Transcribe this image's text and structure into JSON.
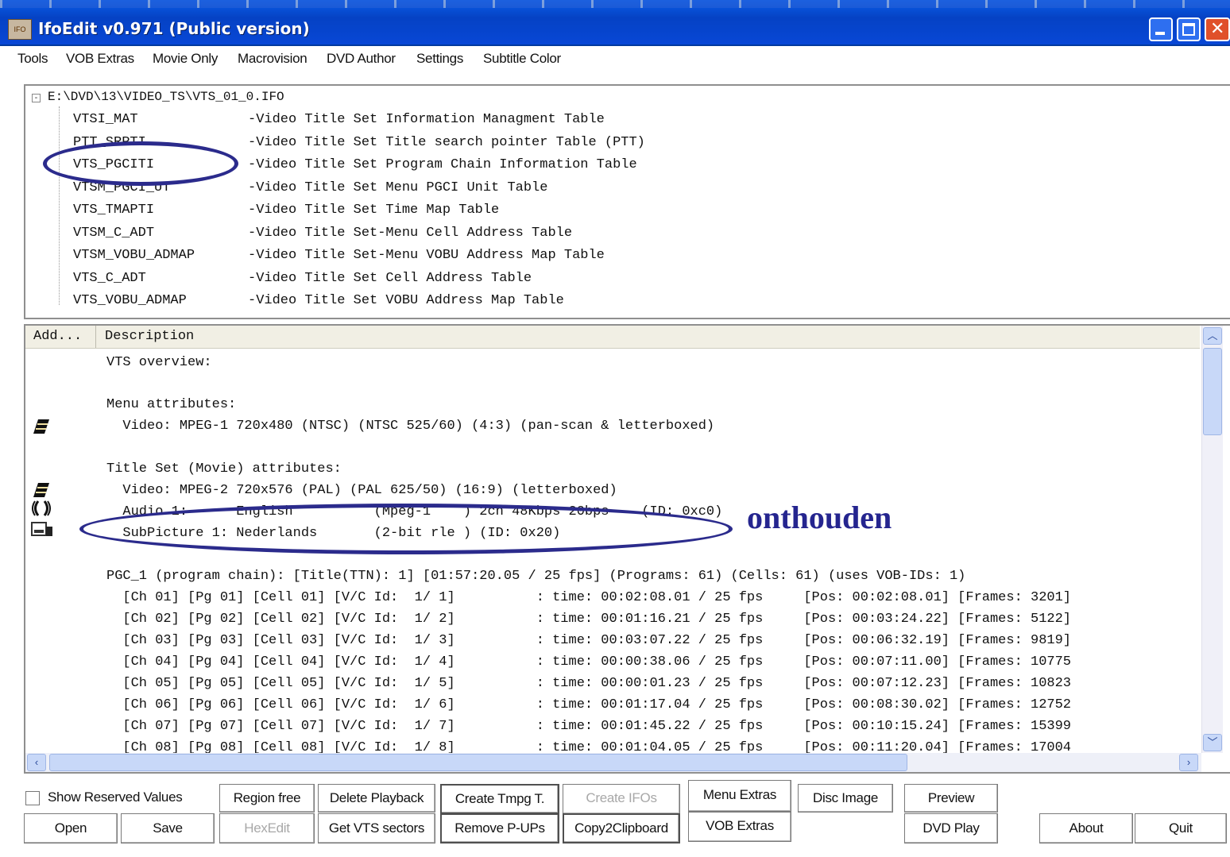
{
  "window": {
    "title": "IfoEdit v0.971 (Public version)",
    "app_icon": "ifo-app-icon",
    "controls": [
      "minimize-icon",
      "maximize-icon",
      "close-icon"
    ]
  },
  "menu": [
    "Tools",
    "VOB Extras",
    "Movie Only",
    "Macrovision",
    "DVD Author",
    "Settings",
    "Subtitle Color"
  ],
  "tree": {
    "root": "E:\\DVD\\13\\VIDEO_TS\\VTS_01_0.IFO",
    "items": [
      {
        "name": "VTSI_MAT",
        "desc": "-Video Title Set Information Managment Table"
      },
      {
        "name": "PTT_SRPTI",
        "desc": "-Video Title Set Title search pointer Table (PTT)"
      },
      {
        "name": "VTS_PGCITI",
        "desc": "-Video Title Set Program Chain Information Table"
      },
      {
        "name": "VTSM_PGCI_UT",
        "desc": "-Video Title Set Menu PGCI Unit Table"
      },
      {
        "name": "VTS_TMAPTI",
        "desc": "-Video Title Set Time Map Table"
      },
      {
        "name": "VTSM_C_ADT",
        "desc": "-Video Title Set-Menu Cell Address Table"
      },
      {
        "name": "VTSM_VOBU_ADMAP",
        "desc": "-Video Title Set-Menu VOBU Address Map Table"
      },
      {
        "name": "VTS_C_ADT",
        "desc": "-Video Title Set Cell Address Table"
      },
      {
        "name": "VTS_VOBU_ADMAP",
        "desc": "-Video Title Set VOBU Address Map Table"
      }
    ]
  },
  "list": {
    "headers": [
      "Add...",
      "Description"
    ],
    "lines": [
      "VTS overview:",
      "",
      "Menu attributes:",
      "  Video: MPEG-1 720x480 (NTSC) (NTSC 525/60) (4:3) (pan-scan & letterboxed)",
      "",
      "Title Set (Movie) attributes:",
      "  Video: MPEG-2 720x576 (PAL) (PAL 625/50) (16:9) (letterboxed)",
      "  Audio 1:      English          (Mpeg-1    ) 2ch 48Kbps 20bps    (ID: 0xc0)",
      "  SubPicture 1: Nederlands       (2-bit rle ) (ID: 0x20)",
      "",
      "PGC_1 (program chain): [Title(TTN): 1] [01:57:20.05 / 25 fps] (Programs: 61) (Cells: 61) (uses VOB-IDs: 1)",
      "  [Ch 01] [Pg 01] [Cell 01] [V/C Id:  1/ 1]          : time: 00:02:08.01 / 25 fps     [Pos: 00:02:08.01] [Frames: 3201]",
      "  [Ch 02] [Pg 02] [Cell 02] [V/C Id:  1/ 2]          : time: 00:01:16.21 / 25 fps     [Pos: 00:03:24.22] [Frames: 5122]",
      "  [Ch 03] [Pg 03] [Cell 03] [V/C Id:  1/ 3]          : time: 00:03:07.22 / 25 fps     [Pos: 00:06:32.19] [Frames: 9819]",
      "  [Ch 04] [Pg 04] [Cell 04] [V/C Id:  1/ 4]          : time: 00:00:38.06 / 25 fps     [Pos: 00:07:11.00] [Frames: 10775",
      "  [Ch 05] [Pg 05] [Cell 05] [V/C Id:  1/ 5]          : time: 00:00:01.23 / 25 fps     [Pos: 00:07:12.23] [Frames: 10823",
      "  [Ch 06] [Pg 06] [Cell 06] [V/C Id:  1/ 6]          : time: 00:01:17.04 / 25 fps     [Pos: 00:08:30.02] [Frames: 12752",
      "  [Ch 07] [Pg 07] [Cell 07] [V/C Id:  1/ 7]          : time: 00:01:45.22 / 25 fps     [Pos: 00:10:15.24] [Frames: 15399",
      "  [Ch 08] [Pg 08] [Cell 08] [V/C Id:  1/ 8]          : time: 00:01:04.05 / 25 fps     [Pos: 00:11:20.04] [Frames: 17004"
    ],
    "icons": [
      "video-icon",
      "video-icon",
      "audio-icon",
      "subpicture-icon"
    ]
  },
  "buttons": {
    "show_reserved": "Show Reserved Values",
    "region_free": "Region free",
    "delete_playback": "Delete Playback",
    "create_tmpg": "Create Tmpg T.",
    "create_ifos": "Create IFOs",
    "menu_extras": "Menu Extras",
    "disc_image": "Disc Image",
    "preview": "Preview",
    "open": "Open",
    "save": "Save",
    "hexedit": "HexEdit",
    "get_vts_sectors": "Get VTS sectors",
    "remove_pups": "Remove P-UPs",
    "copy2clipboard": "Copy2Clipboard",
    "vob_extras": "VOB Extras",
    "dvd_play": "DVD Play",
    "about": "About",
    "quit": "Quit"
  },
  "annotation": {
    "text": "onthouden",
    "color": "#25258f"
  }
}
